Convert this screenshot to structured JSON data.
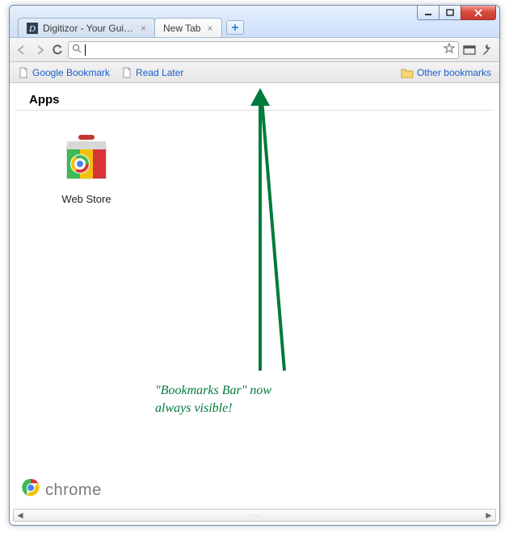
{
  "tabs": [
    {
      "title": "Digitizor - Your Guide to ...",
      "active": false,
      "favicon": "D"
    },
    {
      "title": "New Tab",
      "active": true,
      "favicon": ""
    }
  ],
  "bookmarks": {
    "items": [
      {
        "label": "Google Bookmark"
      },
      {
        "label": "Read Later"
      }
    ],
    "other_label": "Other bookmarks"
  },
  "omnibox": {
    "value": ""
  },
  "content": {
    "apps_heading": "Apps",
    "apps": [
      {
        "name": "Web Store"
      }
    ],
    "branding": "chrome"
  },
  "annotation": {
    "line1": "\"Bookmarks Bar\" now",
    "line2": "always visible!"
  }
}
